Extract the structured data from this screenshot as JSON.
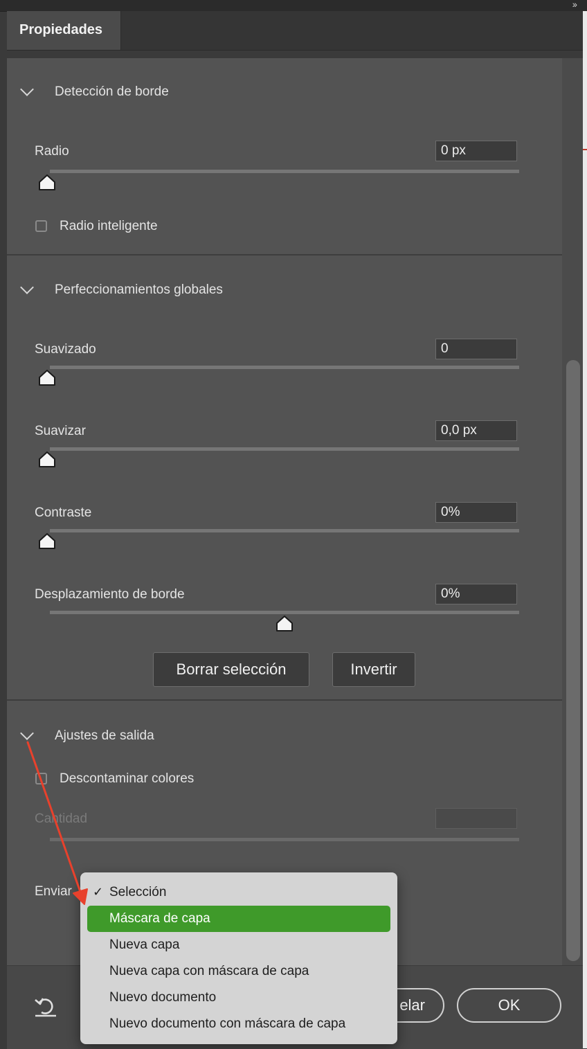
{
  "tab": {
    "label": "Propiedades"
  },
  "edge_detection": {
    "title": "Detección de borde",
    "radius": {
      "label": "Radio",
      "value": "0 px",
      "level_percent": 0
    },
    "smart_radius": {
      "label": "Radio inteligente",
      "checked": false
    }
  },
  "global_refinements": {
    "title": "Perfeccionamientos globales",
    "smooth": {
      "label": "Suavizado",
      "value": "0",
      "level_percent": 0
    },
    "feather": {
      "label": "Suavizar",
      "value": "0,0 px",
      "level_percent": 0
    },
    "contrast": {
      "label": "Contraste",
      "value": "0%",
      "level_percent": 0
    },
    "shift_edge": {
      "label": "Desplazamiento de borde",
      "value": "0%",
      "level_percent": 50
    },
    "clear_button": "Borrar selección",
    "invert_button": "Invertir"
  },
  "output_settings": {
    "title": "Ajustes de salida",
    "decontaminate": {
      "label": "Descontaminar colores",
      "checked": false
    },
    "amount": {
      "label": "Cantidad",
      "value": ""
    },
    "output_to": {
      "label": "Enviar"
    }
  },
  "output_menu": {
    "checked_item": "Selección",
    "items": [
      "Máscara de capa",
      "Nueva capa",
      "Nueva capa con máscara de capa",
      "Nuevo documento",
      "Nuevo documento con máscara de capa"
    ],
    "highlighted_index": 0
  },
  "footer": {
    "cancel_partial": "elar",
    "ok_label": "OK"
  },
  "colors": {
    "panel_bg": "#535353",
    "menu_highlight": "#3f9a2a",
    "annotation_arrow": "#e8412c"
  }
}
